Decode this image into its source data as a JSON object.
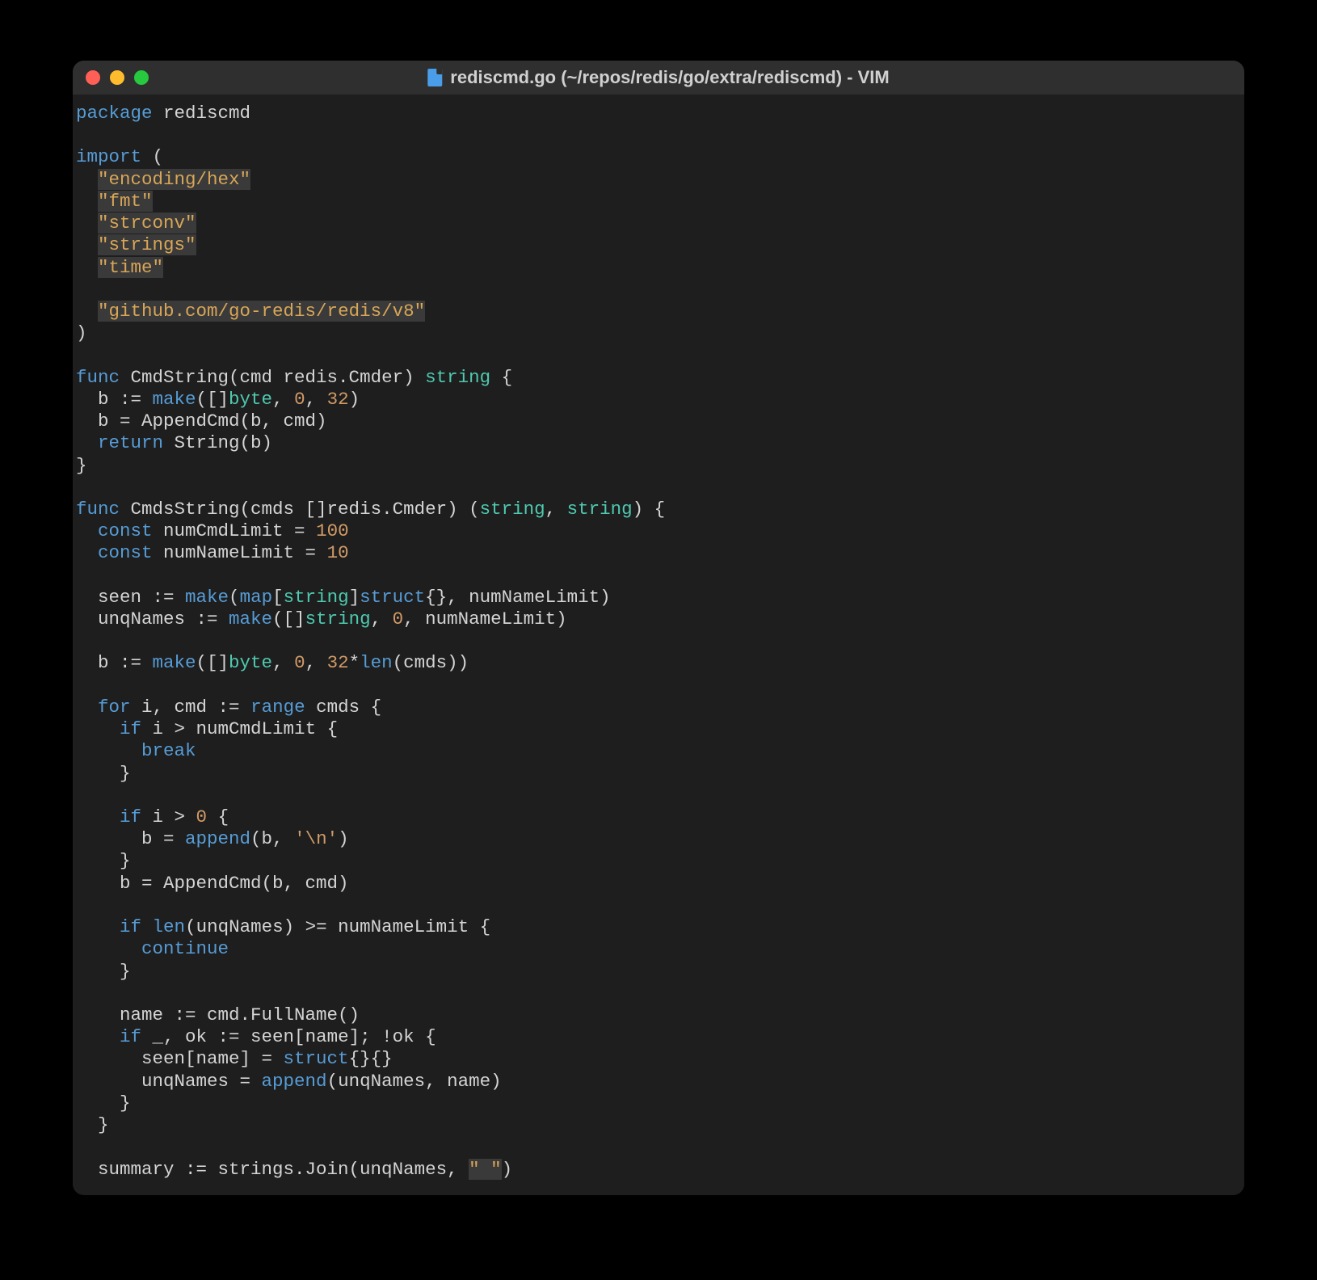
{
  "window": {
    "title": "rediscmd.go (~/repos/redis/go/extra/rediscmd) - VIM"
  },
  "code": {
    "lines": [
      [
        {
          "t": "package",
          "c": "kw"
        },
        {
          "t": " rediscmd"
        }
      ],
      [],
      [
        {
          "t": "import",
          "c": "kw"
        },
        {
          "t": " ("
        }
      ],
      [
        {
          "t": "  "
        },
        {
          "t": "\"encoding/hex\"",
          "c": "str"
        }
      ],
      [
        {
          "t": "  "
        },
        {
          "t": "\"fmt\"",
          "c": "str"
        }
      ],
      [
        {
          "t": "  "
        },
        {
          "t": "\"strconv\"",
          "c": "str"
        }
      ],
      [
        {
          "t": "  "
        },
        {
          "t": "\"strings\"",
          "c": "str"
        }
      ],
      [
        {
          "t": "  "
        },
        {
          "t": "\"time\"",
          "c": "str"
        }
      ],
      [],
      [
        {
          "t": "  "
        },
        {
          "t": "\"github.com/go-redis/redis/v8\"",
          "c": "str"
        }
      ],
      [
        {
          "t": ")"
        }
      ],
      [],
      [
        {
          "t": "func",
          "c": "kw"
        },
        {
          "t": " CmdString(cmd redis.Cmder) "
        },
        {
          "t": "string",
          "c": "type"
        },
        {
          "t": " {"
        }
      ],
      [
        {
          "t": "  b := "
        },
        {
          "t": "make",
          "c": "bi"
        },
        {
          "t": "([]"
        },
        {
          "t": "byte",
          "c": "type"
        },
        {
          "t": ", "
        },
        {
          "t": "0",
          "c": "num"
        },
        {
          "t": ", "
        },
        {
          "t": "32",
          "c": "num"
        },
        {
          "t": ")"
        }
      ],
      [
        {
          "t": "  b = AppendCmd(b, cmd)"
        }
      ],
      [
        {
          "t": "  "
        },
        {
          "t": "return",
          "c": "kw"
        },
        {
          "t": " String(b)"
        }
      ],
      [
        {
          "t": "}"
        }
      ],
      [],
      [
        {
          "t": "func",
          "c": "kw"
        },
        {
          "t": " CmdsString(cmds []redis.Cmder) ("
        },
        {
          "t": "string",
          "c": "type"
        },
        {
          "t": ", "
        },
        {
          "t": "string",
          "c": "type"
        },
        {
          "t": ") {"
        }
      ],
      [
        {
          "t": "  "
        },
        {
          "t": "const",
          "c": "kw"
        },
        {
          "t": " numCmdLimit = "
        },
        {
          "t": "100",
          "c": "num"
        }
      ],
      [
        {
          "t": "  "
        },
        {
          "t": "const",
          "c": "kw"
        },
        {
          "t": " numNameLimit = "
        },
        {
          "t": "10",
          "c": "num"
        }
      ],
      [],
      [
        {
          "t": "  seen := "
        },
        {
          "t": "make",
          "c": "bi"
        },
        {
          "t": "("
        },
        {
          "t": "map",
          "c": "kw"
        },
        {
          "t": "["
        },
        {
          "t": "string",
          "c": "type"
        },
        {
          "t": "]"
        },
        {
          "t": "struct",
          "c": "kw"
        },
        {
          "t": "{}, numNameLimit)"
        }
      ],
      [
        {
          "t": "  unqNames := "
        },
        {
          "t": "make",
          "c": "bi"
        },
        {
          "t": "([]"
        },
        {
          "t": "string",
          "c": "type"
        },
        {
          "t": ", "
        },
        {
          "t": "0",
          "c": "num"
        },
        {
          "t": ", numNameLimit)"
        }
      ],
      [],
      [
        {
          "t": "  b := "
        },
        {
          "t": "make",
          "c": "bi"
        },
        {
          "t": "([]"
        },
        {
          "t": "byte",
          "c": "type"
        },
        {
          "t": ", "
        },
        {
          "t": "0",
          "c": "num"
        },
        {
          "t": ", "
        },
        {
          "t": "32",
          "c": "num"
        },
        {
          "t": "*"
        },
        {
          "t": "len",
          "c": "bi"
        },
        {
          "t": "(cmds))"
        }
      ],
      [],
      [
        {
          "t": "  "
        },
        {
          "t": "for",
          "c": "kw"
        },
        {
          "t": " i, cmd := "
        },
        {
          "t": "range",
          "c": "kw"
        },
        {
          "t": " cmds {"
        }
      ],
      [
        {
          "t": "    "
        },
        {
          "t": "if",
          "c": "kw"
        },
        {
          "t": " i > numCmdLimit {"
        }
      ],
      [
        {
          "t": "      "
        },
        {
          "t": "break",
          "c": "kw"
        }
      ],
      [
        {
          "t": "    }"
        }
      ],
      [],
      [
        {
          "t": "    "
        },
        {
          "t": "if",
          "c": "kw"
        },
        {
          "t": " i > "
        },
        {
          "t": "0",
          "c": "num"
        },
        {
          "t": " {"
        }
      ],
      [
        {
          "t": "      b = "
        },
        {
          "t": "append",
          "c": "bi"
        },
        {
          "t": "(b, "
        },
        {
          "t": "'\\n'",
          "c": "ch"
        },
        {
          "t": ")"
        }
      ],
      [
        {
          "t": "    }"
        }
      ],
      [
        {
          "t": "    b = AppendCmd(b, cmd)"
        }
      ],
      [],
      [
        {
          "t": "    "
        },
        {
          "t": "if",
          "c": "kw"
        },
        {
          "t": " "
        },
        {
          "t": "len",
          "c": "bi"
        },
        {
          "t": "(unqNames) >= numNameLimit {"
        }
      ],
      [
        {
          "t": "      "
        },
        {
          "t": "continue",
          "c": "kw"
        }
      ],
      [
        {
          "t": "    }"
        }
      ],
      [],
      [
        {
          "t": "    name := cmd.FullName()"
        }
      ],
      [
        {
          "t": "    "
        },
        {
          "t": "if",
          "c": "kw"
        },
        {
          "t": " _, ok := seen[name]; !ok {"
        }
      ],
      [
        {
          "t": "      seen[name] = "
        },
        {
          "t": "struct",
          "c": "kw"
        },
        {
          "t": "{}{}"
        }
      ],
      [
        {
          "t": "      unqNames = "
        },
        {
          "t": "append",
          "c": "bi"
        },
        {
          "t": "(unqNames, name)"
        }
      ],
      [
        {
          "t": "    }"
        }
      ],
      [
        {
          "t": "  }"
        }
      ],
      [],
      [
        {
          "t": "  summary := strings.Join(unqNames, "
        },
        {
          "t": "\" \"",
          "c": "str"
        },
        {
          "t": ")"
        }
      ]
    ]
  }
}
